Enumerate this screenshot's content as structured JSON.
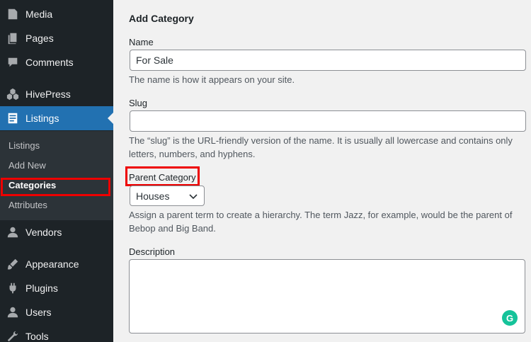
{
  "sidebar": {
    "items": [
      {
        "label": "Media",
        "icon": "media-icon"
      },
      {
        "label": "Pages",
        "icon": "pages-icon"
      },
      {
        "label": "Comments",
        "icon": "comments-icon"
      },
      {
        "label": "HivePress",
        "icon": "hivepress-icon"
      },
      {
        "label": "Listings",
        "icon": "listings-icon",
        "active": true
      },
      {
        "label": "Vendors",
        "icon": "vendors-icon"
      },
      {
        "label": "Appearance",
        "icon": "appearance-icon"
      },
      {
        "label": "Plugins",
        "icon": "plugins-icon"
      },
      {
        "label": "Users",
        "icon": "users-icon"
      },
      {
        "label": "Tools",
        "icon": "tools-icon"
      }
    ],
    "submenu": [
      {
        "label": "Listings"
      },
      {
        "label": "Add New"
      },
      {
        "label": "Categories",
        "current": true
      },
      {
        "label": "Attributes"
      }
    ]
  },
  "form": {
    "title": "Add Category",
    "name_label": "Name",
    "name_value": "For Sale",
    "name_help": "The name is how it appears on your site.",
    "slug_label": "Slug",
    "slug_value": "",
    "slug_help": "The “slug” is the URL-friendly version of the name. It is usually all lowercase and contains only letters, numbers, and hyphens.",
    "parent_label": "Parent Category",
    "parent_value": "Houses",
    "parent_help": "Assign a parent term to create a hierarchy. The term Jazz, for example, would be the parent of Bebop and Big Band.",
    "description_label": "Description",
    "description_value": ""
  },
  "colors": {
    "sidebar_bg": "#1d2327",
    "submenu_bg": "#2c3338",
    "active_bg": "#2271b1",
    "highlight": "#ee0000",
    "grammarly": "#15c39a"
  }
}
